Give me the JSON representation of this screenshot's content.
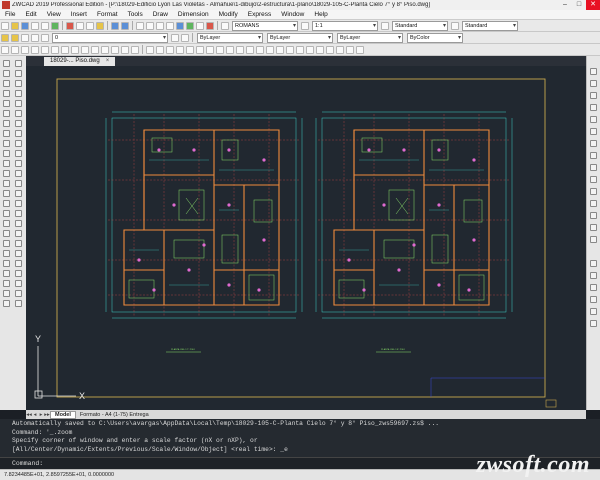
{
  "window": {
    "title": "ZWCAD 2019 Professional Edition - [P:\\18029-Edificio Lyon Las Violetas - Almahue\\1-dibujo\\2-estructura\\1-plano\\18029-105-C-Planta Cielo 7° y 8° Piso.dwg]",
    "minimize": "–",
    "maximize": "□",
    "close": "✕"
  },
  "menu": [
    "File",
    "Edit",
    "View",
    "Insert",
    "Format",
    "Tools",
    "Draw",
    "Dimension",
    "Modify",
    "Express",
    "Window",
    "Help"
  ],
  "toolbar": {
    "font_combo": "ROMANS",
    "scale_combo": "1:1",
    "text_style": "Standard",
    "dim_style": "Standard",
    "layer_combo": "0",
    "color_combo": "ByLayer",
    "linetype_combo": "ByLayer",
    "lineweight_combo": "ByLayer",
    "plotstyle_combo": "ByColor"
  },
  "document_tab": {
    "label": "18029-... Piso.dwg",
    "close": "×"
  },
  "canvas": {
    "ucs_y": "Y",
    "ucs_x": "X",
    "plan_labels": [
      "PLANTA CIELO 7° PISO",
      "PLANTA CIELO 8° PISO"
    ]
  },
  "layout_tabs": {
    "nav": [
      "◂◂",
      "◂",
      "▸",
      "▸▸"
    ],
    "tabs": [
      "Model",
      "Formato - A4 (1-75) Entrega"
    ]
  },
  "command_history": [
    "Automatically saved to C:\\Users\\avargas\\AppData\\Local\\Temp\\18029-105-C-Planta Cielo 7° y 8° Piso_zws59697.zs$ ...",
    "Command: '_.zoom",
    "Specify corner of window and enter a scale factor (nX or nXP), or",
    "[All/Center/Dynamic/Extents/Previous/Scale/Window/Object] <real time>: _e"
  ],
  "command_prompt": {
    "label": "Command:",
    "value": ""
  },
  "status": {
    "coords": "7.8234485E+01, 2.8597255E+01, 0.0000000"
  },
  "watermark": "zwsoft.com",
  "colors": {
    "accent_frame": "#c9a94e",
    "wall": "#f08a3c",
    "dim_line": "#3fd0c6",
    "detail": "#8adf6a",
    "marker": "#e06ad0",
    "grid": "#e04848"
  }
}
